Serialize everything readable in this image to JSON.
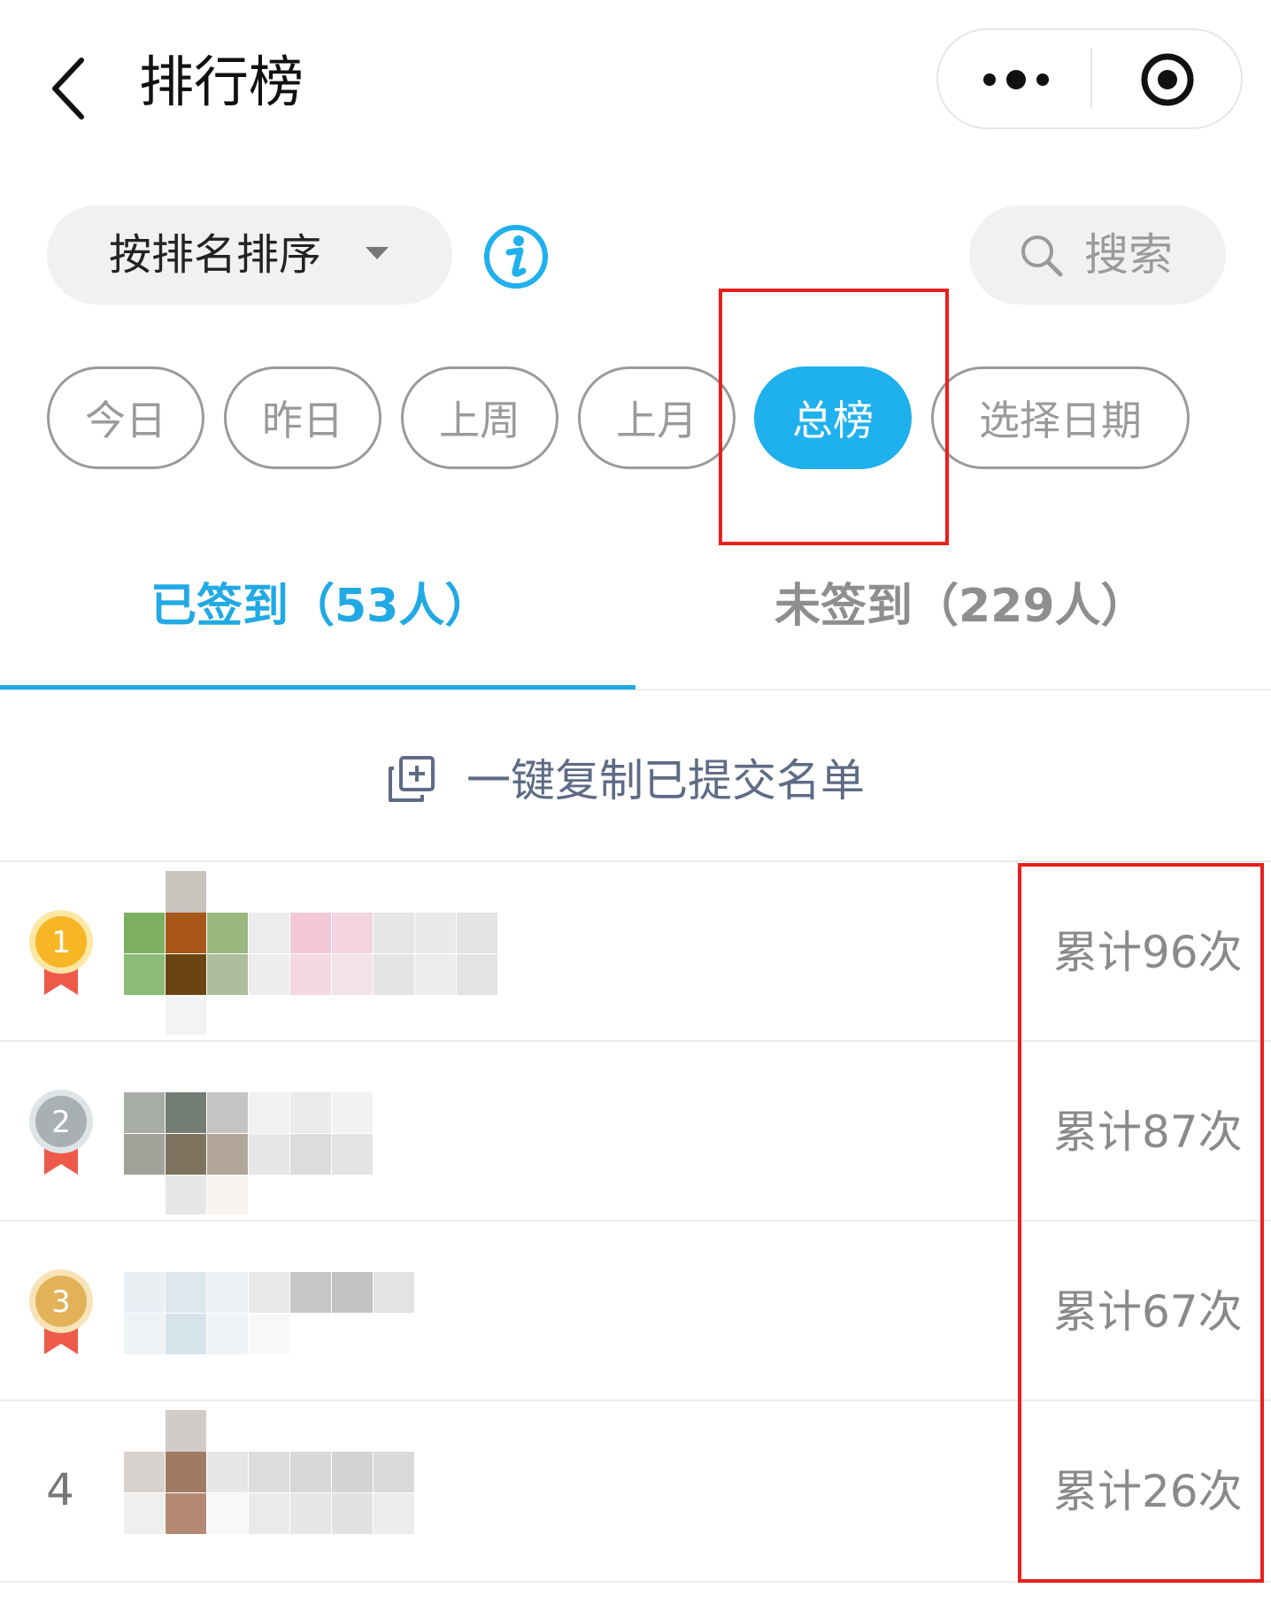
{
  "nav": {
    "title": "排行榜",
    "icons": [
      "back-arrow-icon",
      "more-dots-icon",
      "close-target-icon"
    ]
  },
  "toolbar": {
    "sort_label": "按排名排序",
    "info_icon": "info-icon",
    "search_label": "搜索"
  },
  "filters": {
    "chips": [
      "今日",
      "昨日",
      "上周",
      "上月",
      "总榜",
      "选择日期"
    ],
    "active": "总榜"
  },
  "tabs": {
    "checked_in": "已签到（53人）",
    "not_checked_in": "未签到（229人）",
    "active": "已签到（53人）"
  },
  "copy_action": {
    "label": "一键复制已提交名单",
    "icon": "copy-add-icon"
  },
  "ranking": [
    {
      "rank": "1",
      "medal": "gold",
      "count": "累计96次"
    },
    {
      "rank": "2",
      "medal": "silver",
      "count": "累计87次"
    },
    {
      "rank": "3",
      "medal": "bronze",
      "count": "累计67次"
    },
    {
      "rank": "4",
      "medal": "",
      "count": "累计26次"
    }
  ],
  "colors": {
    "accent": "#1fb0ee",
    "highlight": "#e8201c",
    "gold": "#f6b625",
    "silver": "#a8b0b4",
    "bronze": "#e2b258",
    "ribbon": "#ee5a4a"
  }
}
